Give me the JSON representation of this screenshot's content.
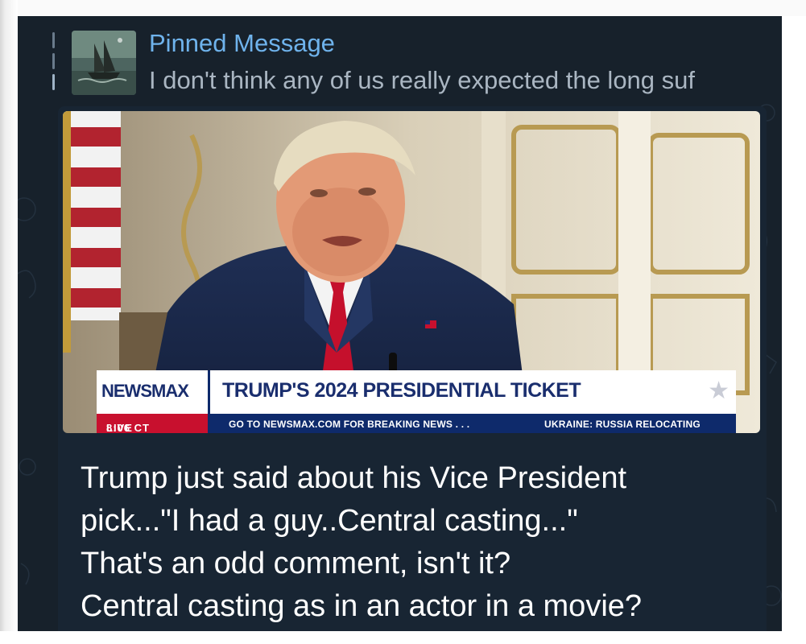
{
  "pinned": {
    "title": "Pinned Message",
    "preview": "I don't think any of us really expected the long suf",
    "thumbnail_icon": "ship-painting-thumbnail"
  },
  "post": {
    "media": {
      "type": "video-frame",
      "lower_third": {
        "brand": "NEWSMAX",
        "headline": "TRUMP'S 2024 PRESIDENTIAL TICKET",
        "time": "8:06 CT",
        "live": "LIVE",
        "ticker_1": "GO TO NEWSMAX.COM FOR BREAKING NEWS . . .",
        "ticker_2": "UKRAINE: RUSSIA RELOCATING"
      }
    },
    "caption_lines": [
      "Trump just said about his Vice President",
      "pick...\"I had a guy..Central casting...\"",
      "That's an odd comment, isn't it?",
      "Central casting as in an actor in a movie?"
    ]
  },
  "colors": {
    "app_background": "#17212b",
    "bubble": "#182533",
    "pinned_title": "#6fb3ec",
    "pinned_text": "#aab6c2",
    "newsmax_navy": "#1a2e6e",
    "newsmax_red": "#c8102e"
  }
}
